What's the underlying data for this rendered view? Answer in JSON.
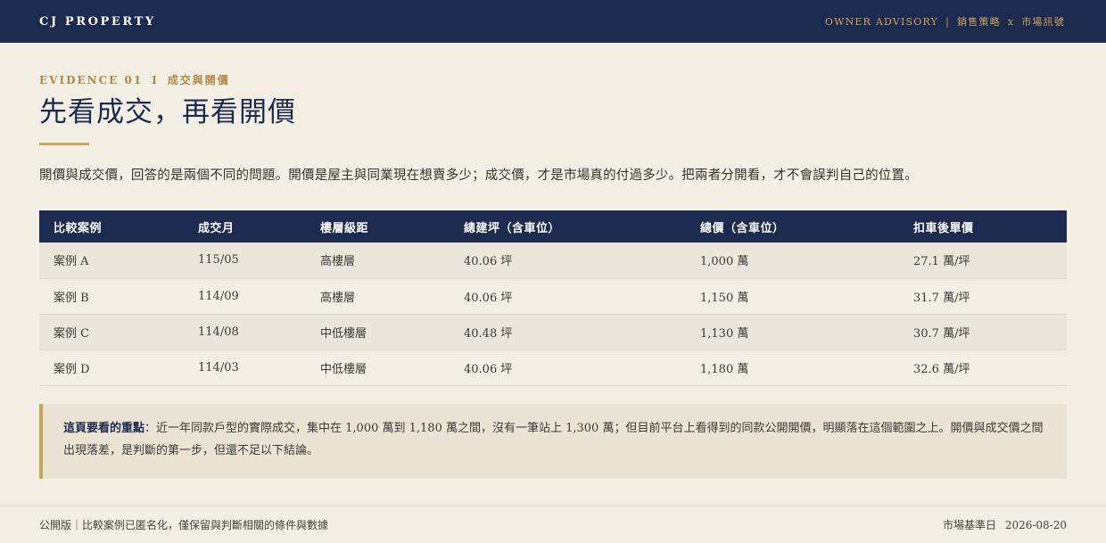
{
  "header": {
    "brand": "CJ PROPERTY",
    "nav_left": "OWNER ADVISORY",
    "nav_divider": "|",
    "nav_mid": "銷售策略",
    "nav_cross": "x",
    "nav_right": "市場訊號"
  },
  "section": {
    "eyebrow_label": "EVIDENCE 01",
    "eyebrow_divider": "I",
    "eyebrow_topic": "成交與開價",
    "title": "先看成交，再看開價",
    "intro": "開價與成交價，回答的是兩個不同的問題。開價是屋主與同業現在想賣多少；成交價，才是市場真的付過多少。把兩者分開看，才不會誤判自己的位置。"
  },
  "table": {
    "headers": [
      "比較案例",
      "成交月",
      "樓層級距",
      "總建坪（含車位）",
      "總價（含車位）",
      "扣車後單價"
    ],
    "rows": [
      [
        "案例 A",
        "115/05",
        "高樓層",
        "40.06 坪",
        "1,000 萬",
        "27.1 萬/坪"
      ],
      [
        "案例 B",
        "114/09",
        "高樓層",
        "40.06 坪",
        "1,150 萬",
        "31.7 萬/坪"
      ],
      [
        "案例 C",
        "114/08",
        "中低樓層",
        "40.48 坪",
        "1,130 萬",
        "30.7 萬/坪"
      ],
      [
        "案例 D",
        "114/03",
        "中低樓層",
        "40.06 坪",
        "1,180 萬",
        "32.6 萬/坪"
      ]
    ]
  },
  "callout": {
    "label": "這頁要看的重點",
    "text": "：近一年同款戶型的實際成交，集中在 1,000 萬到 1,180 萬之間，沒有一筆站上 1,300 萬；但目前平台上看得到的同款公開開價，明顯落在這個範圍之上。開價與成交價之間出現落差，是判斷的第一步，但還不足以下結論。"
  },
  "footer": {
    "left": "公開版｜比較案例已匿名化，僅保留與判斷相關的條件與數據",
    "right_label": "市場基準日",
    "right_date": "2026-08-20"
  },
  "colors": {
    "navy": "#1b2a4e",
    "gold": "#c9a55c",
    "background": "#f3efe5"
  }
}
